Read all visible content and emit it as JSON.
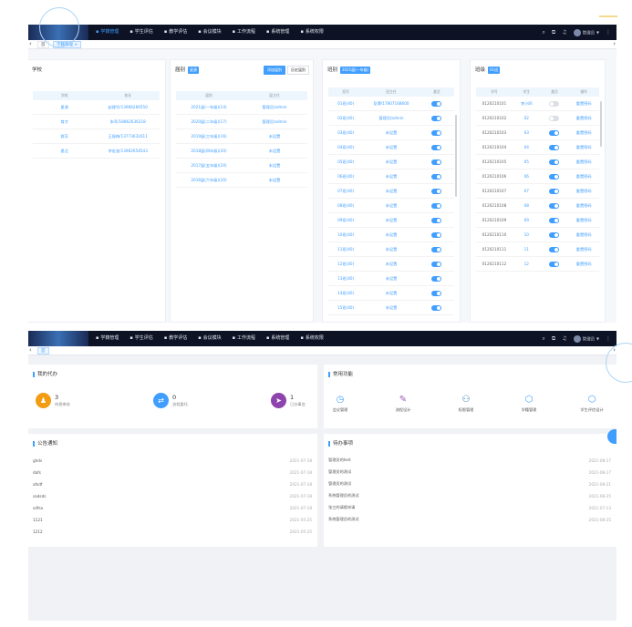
{
  "nav": {
    "items": [
      "学籍管理",
      "学生评估",
      "教学评估",
      "会议模块",
      "工作流程",
      "系统管理",
      "系统权限"
    ],
    "icons": [
      "grid-icon",
      "edit-icon",
      "chart-icon",
      "people-icon",
      "flow-icon",
      "gear-icon",
      "lock-icon"
    ],
    "user": "管理员"
  },
  "nav2": {
    "user": "管理员"
  },
  "tabs": {
    "home": "首",
    "active": "学籍管理 ×"
  },
  "school": {
    "title": "学校",
    "headers": [
      "学校",
      "校长"
    ],
    "rows": [
      [
        "星源",
        "赵建华/13966266550"
      ],
      [
        "育才",
        "朱军/18862636218"
      ],
      [
        "群芳",
        "王振梅/13773631611"
      ],
      [
        "星达",
        "李宏波/13962654543"
      ]
    ]
  },
  "grade": {
    "title": "届别",
    "badge": "星源",
    "btn_add": "添加届别",
    "btn_hist": "历史届别",
    "headers": [
      "届别",
      "届主任"
    ],
    "rows": [
      [
        "2021届(一年级)(14)",
        "管理员/admin"
      ],
      [
        "2020届(二年级)(17)",
        "管理员/admin"
      ],
      [
        "2019届(三年级)(16)",
        "未设置"
      ],
      [
        "2018届(四年级)(20)",
        "未设置"
      ],
      [
        "2017届(五年级)(20)",
        "未设置"
      ],
      [
        "2016届(六年级)(20)",
        "未设置"
      ]
    ]
  },
  "klass": {
    "title": "班别",
    "badge": "2021届(一年级)",
    "headers": [
      "班号",
      "班主任",
      "激活"
    ],
    "rows": [
      [
        "01班(40)",
        "彭博/17807168600",
        true
      ],
      [
        "02班(40)",
        "管理员/admin",
        true
      ],
      [
        "03班(40)",
        "未设置",
        true
      ],
      [
        "04班(40)",
        "未设置",
        true
      ],
      [
        "05班(40)",
        "未设置",
        true
      ],
      [
        "06班(40)",
        "未设置",
        true
      ],
      [
        "07班(40)",
        "未设置",
        true
      ],
      [
        "08班(40)",
        "未设置",
        true
      ],
      [
        "09班(40)",
        "未设置",
        true
      ],
      [
        "10班(40)",
        "未设置",
        true
      ],
      [
        "11班(40)",
        "未设置",
        true
      ],
      [
        "12班(40)",
        "未设置",
        true
      ],
      [
        "13班(40)",
        "未设置",
        true
      ],
      [
        "14班(40)",
        "未设置",
        true
      ],
      [
        "15班(40)",
        "未设置",
        true
      ]
    ]
  },
  "student": {
    "title": "班级",
    "badge": "01班",
    "headers": [
      "学号",
      "学生",
      "激活",
      "操作"
    ],
    "rows": [
      [
        "0120210101",
        "李小四",
        false,
        "重置密码"
      ],
      [
        "0120210102",
        "02",
        false,
        "重置密码"
      ],
      [
        "0120210103",
        "03",
        true,
        "重置密码"
      ],
      [
        "0120210104",
        "04",
        true,
        "重置密码"
      ],
      [
        "0120210105",
        "05",
        true,
        "重置密码"
      ],
      [
        "0120210106",
        "06",
        true,
        "重置密码"
      ],
      [
        "0120210107",
        "07",
        true,
        "重置密码"
      ],
      [
        "0120210108",
        "08",
        true,
        "重置密码"
      ],
      [
        "0120210109",
        "09",
        true,
        "重置密码"
      ],
      [
        "0120210110",
        "10",
        true,
        "重置密码"
      ],
      [
        "0120210111",
        "11",
        true,
        "重置密码"
      ],
      [
        "0120210112",
        "12",
        true,
        "重置密码"
      ]
    ]
  },
  "todo": {
    "title": "我的代办",
    "stats": [
      {
        "num": "3",
        "label": "待我审核",
        "color": "#f39c12",
        "icon": "user-icon"
      },
      {
        "num": "0",
        "label": "流程委托",
        "color": "#409eff",
        "icon": "share-icon"
      },
      {
        "num": "1",
        "label": "已办事宜",
        "color": "#8e44ad",
        "icon": "send-icon"
      }
    ]
  },
  "functions": {
    "title": "常用功能",
    "items": [
      {
        "label": "会议管理",
        "icon": "clock-icon",
        "color": "#409eff"
      },
      {
        "label": "流程设计",
        "icon": "pen-icon",
        "color": "#9b59b6"
      },
      {
        "label": "权限管理",
        "icon": "people-icon",
        "color": "#2980b9"
      },
      {
        "label": "学籍管理",
        "icon": "cube-icon",
        "color": "#409eff"
      },
      {
        "label": "学生评估设计",
        "icon": "cube-icon",
        "color": "#409eff"
      }
    ]
  },
  "notices": {
    "title": "公告通知",
    "rows": [
      [
        "ghds",
        "2021-07-18"
      ],
      [
        "dafs",
        "2021-07-18"
      ],
      [
        "afsdf",
        "2021-07-18"
      ],
      [
        "sadsds",
        "2021-07-18"
      ],
      [
        "sdfsa",
        "2021-07-18"
      ],
      [
        "1121",
        "2021-05-25"
      ],
      [
        "1212",
        "2021-05-25"
      ]
    ]
  },
  "tasks": {
    "title": "待办事项",
    "rows": [
      [
        "管理员的test",
        "2021-08-17"
      ],
      [
        "管理员的测试",
        "2021-08-17"
      ],
      [
        "管理员的测试",
        "2021-08-21"
      ],
      [
        "系统管理员的测试",
        "2021-08-25"
      ],
      [
        "张三的请假申请",
        "2021-07-13"
      ],
      [
        "系统管理员的测试",
        "2021-08-25"
      ]
    ]
  }
}
